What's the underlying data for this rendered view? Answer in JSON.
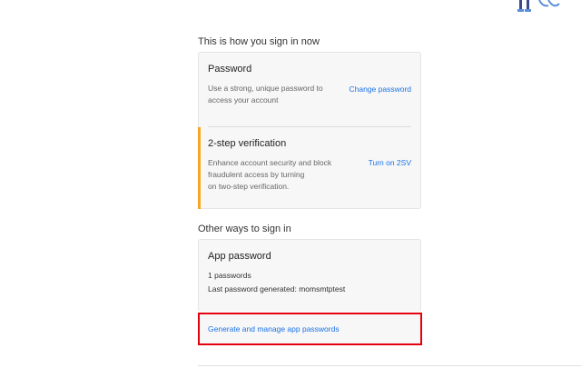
{
  "current": {
    "section_title": "This is how you sign in now",
    "password": {
      "title": "Password",
      "desc_line1": "Use a strong, unique password to",
      "desc_line2": "access your account",
      "link": "Change password"
    },
    "two_step": {
      "title": "2-step verification",
      "desc_line1": "Enhance account security and block",
      "desc_line2": "fraudulent access by turning",
      "desc_line3": "on two-step verification.",
      "link": "Turn on 2SV",
      "accent_color": "#f5a623"
    }
  },
  "other": {
    "section_title": "Other ways to sign in",
    "app_password": {
      "title": "App password",
      "count": "1 passwords",
      "last_generated_label": "Last password generated:",
      "last_generated_value": "momsmtptest",
      "manage_link": "Generate and manage app passwords",
      "highlight_color": "#e3000f"
    }
  },
  "colors": {
    "link": "#1a73e8"
  }
}
